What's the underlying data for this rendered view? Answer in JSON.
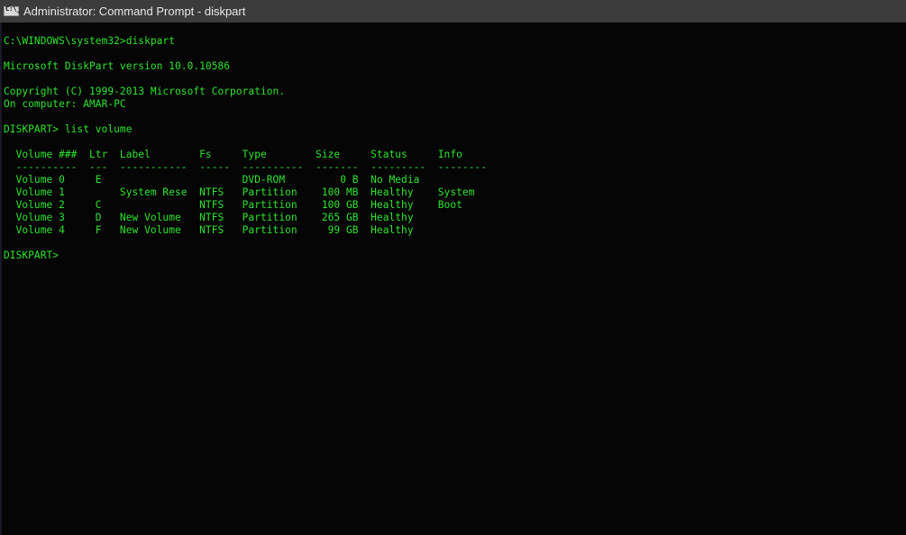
{
  "window": {
    "title": "Administrator: Command Prompt - diskpart",
    "icon": "cmd-icon"
  },
  "console": {
    "text_color": "#2ee32e",
    "background": "#050505",
    "lines": [
      "C:\\WINDOWS\\system32>diskpart",
      "",
      "Microsoft DiskPart version 10.0.10586",
      "",
      "Copyright (C) 1999-2013 Microsoft Corporation.",
      "On computer: AMAR-PC",
      "",
      "DISKPART> list volume",
      "",
      "  Volume ###  Ltr  Label        Fs     Type        Size     Status     Info",
      "  ----------  ---  -----------  -----  ----------  -------  ---------  --------",
      "  Volume 0     E                       DVD-ROM         0 B  No Media",
      "  Volume 1         System Rese  NTFS   Partition    100 MB  Healthy    System",
      "  Volume 2     C                NTFS   Partition    100 GB  Healthy    Boot",
      "  Volume 3     D   New Volume   NTFS   Partition    265 GB  Healthy",
      "  Volume 4     F   New Volume   NTFS   Partition     99 GB  Healthy",
      "",
      "DISKPART> "
    ]
  },
  "volume_table": {
    "columns": [
      "Volume ###",
      "Ltr",
      "Label",
      "Fs",
      "Type",
      "Size",
      "Status",
      "Info"
    ],
    "rows": [
      [
        "Volume 0",
        "E",
        "",
        "",
        "DVD-ROM",
        "0 B",
        "No Media",
        ""
      ],
      [
        "Volume 1",
        "",
        "System Rese",
        "NTFS",
        "Partition",
        "100 MB",
        "Healthy",
        "System"
      ],
      [
        "Volume 2",
        "C",
        "",
        "NTFS",
        "Partition",
        "100 GB",
        "Healthy",
        "Boot"
      ],
      [
        "Volume 3",
        "D",
        "New Volume",
        "NTFS",
        "Partition",
        "265 GB",
        "Healthy",
        ""
      ],
      [
        "Volume 4",
        "F",
        "New Volume",
        "NTFS",
        "Partition",
        "99 GB",
        "Healthy",
        ""
      ]
    ]
  }
}
